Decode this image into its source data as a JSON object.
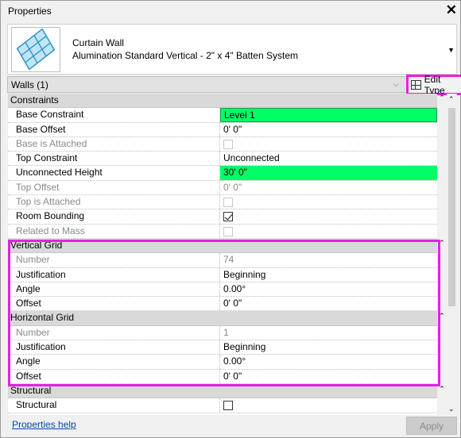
{
  "window": {
    "title": "Properties",
    "close_glyph": "✕"
  },
  "type_selector": {
    "family": "Curtain Wall",
    "type": "Alumination Standard Vertical - 2\" x 4\" Batten System",
    "thumbnail_icon": "curtain-wall-thumbnail"
  },
  "selection": {
    "label": "Walls (1)",
    "edit_type_label": "Edit Type"
  },
  "groups": {
    "constraints": "Constraints",
    "vertical_grid": "Vertical Grid",
    "horizontal_grid": "Horizontal Grid",
    "structural": "Structural"
  },
  "constraints": [
    {
      "name": "Base Constraint",
      "value": "Level 1"
    },
    {
      "name": "Base Offset",
      "value": "0'  0\""
    },
    {
      "name": "Base is Attached",
      "checked": false
    },
    {
      "name": "Top Constraint",
      "value": "Unconnected"
    },
    {
      "name": "Unconnected Height",
      "value": "30'  0\""
    },
    {
      "name": "Top Offset",
      "value": "0'  0\""
    },
    {
      "name": "Top is Attached",
      "checked": false
    },
    {
      "name": "Room Bounding",
      "checked": true
    },
    {
      "name": "Related to Mass",
      "checked": false
    }
  ],
  "vertical_grid": [
    {
      "name": "Number",
      "value": "74"
    },
    {
      "name": "Justification",
      "value": "Beginning"
    },
    {
      "name": "Angle",
      "value": "0.00°"
    },
    {
      "name": "Offset",
      "value": "0'  0\""
    }
  ],
  "horizontal_grid": [
    {
      "name": "Number",
      "value": "1"
    },
    {
      "name": "Justification",
      "value": "Beginning"
    },
    {
      "name": "Angle",
      "value": "0.00°"
    },
    {
      "name": "Offset",
      "value": "0'  0\""
    }
  ],
  "structural": [
    {
      "name": "Structural",
      "checked": false
    }
  ],
  "footer": {
    "help_link": "Properties help",
    "apply_label": "Apply"
  },
  "colors": {
    "highlight": "#e81fe6",
    "edited_value": "#00ff66",
    "group_header": "#d9d9d9"
  }
}
